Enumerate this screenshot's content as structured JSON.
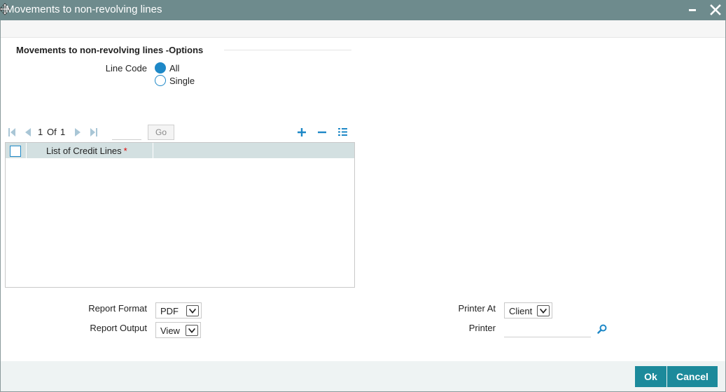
{
  "window": {
    "title": "Movements to non-revolving lines",
    "icons": {
      "move": "move-cursor-icon",
      "minimize": "minimize-icon",
      "close": "close-icon"
    }
  },
  "options": {
    "heading": "Movements to non-revolving lines -Options",
    "line_code": {
      "label": "Line Code",
      "choices": [
        {
          "label": "All",
          "selected": true
        },
        {
          "label": "Single",
          "selected": false
        }
      ]
    }
  },
  "grid": {
    "pager": {
      "current": "1",
      "of_label": "Of",
      "total": "1",
      "go_label": "Go",
      "page_input": ""
    },
    "icons": [
      "first-page-icon",
      "previous-page-icon",
      "next-page-icon",
      "last-page-icon",
      "add-row-icon",
      "delete-row-icon",
      "single-view-icon"
    ],
    "column": "List of Credit Lines",
    "required_marker": "*",
    "rows": []
  },
  "report": {
    "format_label": "Report Format",
    "format_value": "PDF",
    "output_label": "Report Output",
    "output_value": "View",
    "printer_at_label": "Printer At",
    "printer_at_value": "Client",
    "printer_label": "Printer",
    "printer_value": ""
  },
  "buttons": {
    "ok": "Ok",
    "cancel": "Cancel"
  },
  "colors": {
    "titlebar": "#6e8b8d",
    "accent": "#1e88c7",
    "grid_header": "#d3e0e1",
    "button": "#1c8a9b",
    "required": "#dd0000"
  }
}
